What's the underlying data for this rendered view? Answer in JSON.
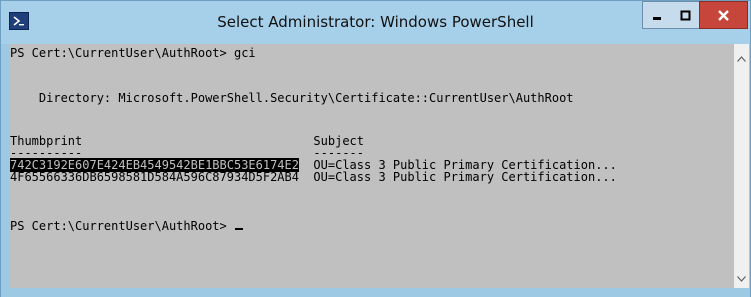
{
  "window": {
    "title": "Select Administrator: Windows PowerShell",
    "app_icon": "powershell-icon",
    "controls": {
      "minimize_icon": "minimize-icon",
      "maximize_icon": "maximize-icon",
      "close_icon": "close-icon"
    }
  },
  "console": {
    "lines": [
      "PS Cert:\\CurrentUser\\AuthRoot> gci",
      "",
      "",
      "    Directory: Microsoft.PowerShell.Security\\Certificate::CurrentUser\\AuthRoot",
      "",
      "",
      "Thumbprint                                Subject",
      "----------                                -------",
      "",
      "4F65566336DB6598581D584A596C87934D5F2AB4  OU=Class 3 Public Primary Certification...",
      "",
      "",
      "PS Cert:\\CurrentUser\\AuthRoot> "
    ],
    "row9_selected": "742C3192E607E424EB4549542BE1BBC53E6174E2",
    "row9_rest": "  OU=Class 3 Public Primary Certification...",
    "colors": {
      "background": "#c0c0c0",
      "text": "#000000",
      "selection_bg": "#000000",
      "selection_fg": "#c0c0c0"
    }
  },
  "scrollbar": {
    "up_icon": "scroll-up-arrow-icon",
    "down_icon": "scroll-down-arrow-icon"
  }
}
